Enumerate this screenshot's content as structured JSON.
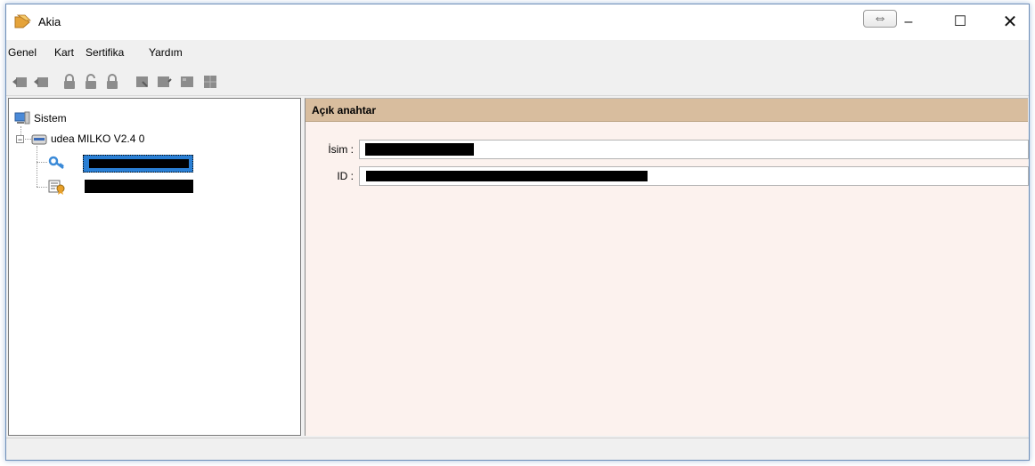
{
  "window": {
    "title": "Akia",
    "resize_glyph": "⇔",
    "minimize_glyph": "–",
    "maximize_glyph": "☐",
    "close_glyph": "✕"
  },
  "menu": {
    "items": [
      "Genel",
      "Kart",
      "Sertifika",
      "Yardım"
    ]
  },
  "toolbar": {
    "icons": [
      "card-add-icon",
      "card-remove-icon",
      "lock-key-icon",
      "unlock-icon",
      "lock-icon",
      "cert-import-icon",
      "cert-export-icon",
      "card-icon",
      "grid-icon"
    ]
  },
  "tree": {
    "root": "Sistem",
    "reader": "udea MILKO V2.4 0",
    "key_item": "",
    "cert_item": ""
  },
  "detail": {
    "header": "Açık anahtar",
    "name_label": "İsim :",
    "name_value": "",
    "id_label": "ID :",
    "id_value": ""
  },
  "colors": {
    "header_bg": "#d8bd9e",
    "panel_bg": "#fcf2ee",
    "window_border": "#6f8fb8"
  }
}
